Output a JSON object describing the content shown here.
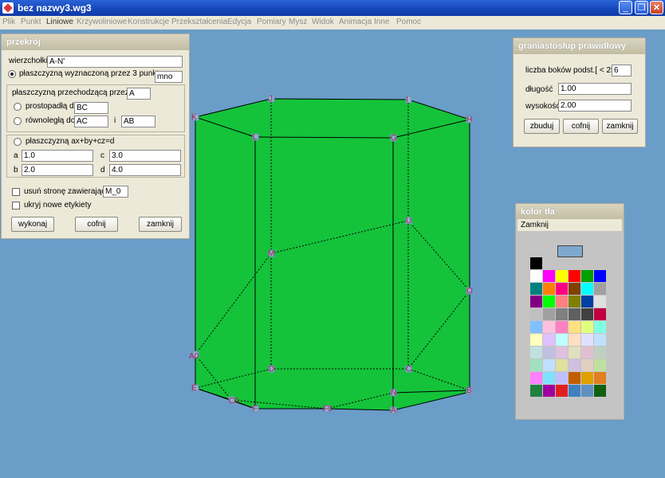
{
  "window": {
    "title": "bez nazwy3.wg3",
    "min_label": "_",
    "max_label": "❐",
    "close_label": "✕"
  },
  "menu": [
    "Plik",
    "Punkt",
    "Liniowe",
    "Krzywoliniowe",
    "Konstrukcje",
    "Przekształcenia",
    "Edycja",
    "Pomiary",
    "Mysz",
    "Widok",
    "Animacja",
    "Inne",
    "Pomoc"
  ],
  "przekroj": {
    "title": "przekrój",
    "wierzcholki_label": "wierzchołki",
    "wierzcholki_value": "A-N'",
    "plane3_label": "płaszczyzną wyznaczoną przez 3 punkty",
    "plane3_value": "mno",
    "through_label": "płaszczyzną przechodzącą przez",
    "through_value": "A",
    "perp_label": "prostopadłą do",
    "perp_value": "BC",
    "par_label": "równoległą do",
    "par_value1": "AC",
    "par_i": "i",
    "par_value2": "AB",
    "equation_label": "płaszczyzną ax+by+cz=d",
    "a_label": "a",
    "a_value": "1.0",
    "b_label": "b",
    "b_value": "2.0",
    "c_label": "c",
    "c_value": "3.0",
    "d_label": "d",
    "d_value": "4.0",
    "remove_label": "usuń stronę zawierającą",
    "remove_value": "M_0",
    "hide_labels": "ukryj nowe etykiety",
    "execute": "wykonaj",
    "undo": "cofnij",
    "close": "zamknij"
  },
  "graniastoslup": {
    "title": "graniastosłup prawidłowy",
    "sides_label": "liczba boków podst.[ < 25 ]",
    "sides_value": "6",
    "length_label": "długość",
    "length_value": "1.00",
    "height_label": "wysokość",
    "height_value": "2.00",
    "build": "zbuduj",
    "undo": "cofnij",
    "close": "zamknij"
  },
  "kolor": {
    "title": "kolor tła",
    "close": "Zamknij",
    "selected": "#7ea9cf",
    "palette": [
      [
        "#000000"
      ],
      [
        "#ffffff",
        "#ff00ff",
        "#ffff00",
        "#ff0000",
        "#00a000",
        "#0000ff"
      ],
      [
        "#008080",
        "#ff8000",
        "#ff0080",
        "#804000",
        "#00ffff",
        "#a0a0a0"
      ],
      [
        "#800080",
        "#00ff00",
        "#ff8080",
        "#808000",
        "#0040a0",
        "#e0e0e0"
      ],
      [
        "#c0c0c0",
        "#a0a0a0",
        "#808080",
        "#606060",
        "#404040",
        "#c00040"
      ],
      [
        "#80c0ff",
        "#ffc0e0",
        "#ff80c0",
        "#ffe080",
        "#e0ff80",
        "#80ffe0"
      ],
      [
        "#ffffc0",
        "#e0c0ff",
        "#c0ffff",
        "#ffe0c0",
        "#e0e0ff",
        "#c0e0ff"
      ],
      [
        "#c0e0e0",
        "#c0c0e0",
        "#e0c0e0",
        "#e0e0c0",
        "#e0c0d0",
        "#c0d0c0"
      ],
      [
        "#a0e0c0",
        "#c0e0ff",
        "#e0e0a0",
        "#d0c0e0",
        "#e0d0c0",
        "#c0e0a0"
      ],
      [
        "#ff80ff",
        "#80e0ff",
        "#c0c0ff",
        "#c06000",
        "#e0a000",
        "#e08020"
      ],
      [
        "#208040",
        "#a000a0",
        "#e02020",
        "#4080c0",
        "#6090c0",
        "#106010"
      ]
    ]
  },
  "prism": {
    "face_color": "#14c33a",
    "labels": [
      "J",
      "I",
      "K",
      "H",
      "L",
      "G",
      "U",
      "M",
      "O",
      "A0",
      "D",
      "C",
      "E",
      "N",
      "B",
      "C0",
      "F",
      "F0",
      "A"
    ]
  }
}
